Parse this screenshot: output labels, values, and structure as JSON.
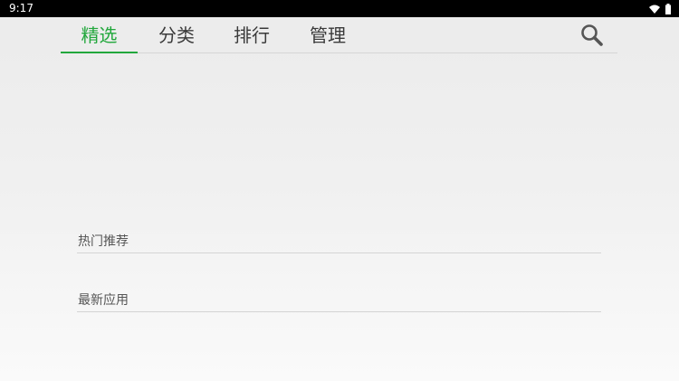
{
  "status_bar": {
    "time": "9:17",
    "icons": [
      "wifi-icon",
      "battery-icon"
    ]
  },
  "tabs": [
    {
      "label": "精选",
      "active": true
    },
    {
      "label": "分类",
      "active": false
    },
    {
      "label": "排行",
      "active": false
    },
    {
      "label": "管理",
      "active": false
    }
  ],
  "search": {
    "icon": "search-icon"
  },
  "sections": [
    {
      "title": "热门推荐"
    },
    {
      "title": "最新应用"
    }
  ],
  "colors": {
    "accent": "#22a73c",
    "status_bar_bg": "#000000"
  }
}
